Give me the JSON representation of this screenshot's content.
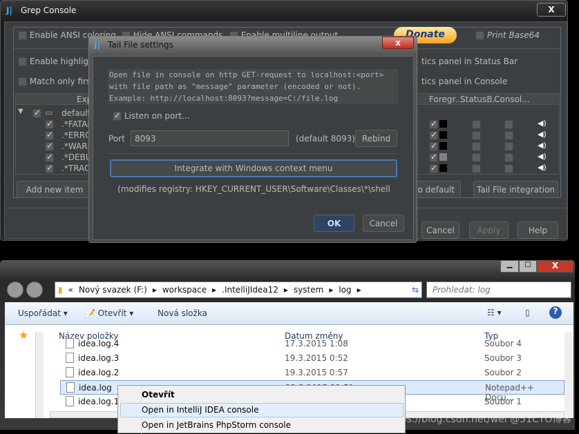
{
  "grep": {
    "title": "Grep Console",
    "close": "X",
    "options": {
      "ansi": "Enable ANSI coloring",
      "hide_ansi": "Hide ANSI commands",
      "multiline": "Enable multiline output",
      "donate": "Donate",
      "base64": "Print Base64",
      "highlight": "Enable highlighting",
      "match_first": "Match only first",
      "stats_status": "tics panel in Status Bar",
      "stats_console": "tics panel in Console"
    },
    "table": {
      "headers": [
        "Exp",
        "Foregr...",
        "StatusB...",
        "Consol..."
      ],
      "rows": [
        {
          "expr": "default",
          "checked": true,
          "folder": true
        },
        {
          "expr": ".*FATAL",
          "checked": true,
          "fg": "#000000"
        },
        {
          "expr": ".*ERROR",
          "checked": true,
          "fg": "#000000"
        },
        {
          "expr": ".*WARN",
          "checked": true,
          "fg": "#000000"
        },
        {
          "expr": ".*DEBUG",
          "checked": true,
          "fg": "#808080"
        },
        {
          "expr": ".*TRACE",
          "checked": true,
          "fg": "#000000"
        }
      ]
    },
    "buttons": {
      "add": "Add new item",
      "reset": "to default",
      "tail": "Tail File integration",
      "cancel": "Cancel",
      "apply": "Apply",
      "help": "Help"
    }
  },
  "tail": {
    "title": "Tail File settings",
    "close": "x",
    "desc": [
      "Open file in console on http GET-request to localhost:<port>",
      "with file path as \"message\" parameter (encoded or not).",
      "Example: http://localhost:8093?message=C:/file.log"
    ],
    "listen": "Listen on port...",
    "listen_checked": true,
    "port_label": "Port",
    "port_value": "8093",
    "port_default": "(default 8093)",
    "rebind": "Rebind",
    "integrate": "Integrate with Windows context menu",
    "registry": "(modifies registry: HKEY_CURRENT_USER\\Software\\Classes\\*\\shell",
    "ok": "OK",
    "cancel": "Cancel"
  },
  "explorer": {
    "path": [
      "«",
      "Nový svazek (F:)",
      "workspace",
      ".IntelliJIdea12",
      "system",
      "log"
    ],
    "search_placeholder": "Prohledat: log",
    "toolbar": {
      "organize": "Uspořádat",
      "open": "Otevřít",
      "new_folder": "Nová složka"
    },
    "columns": [
      "Název položky",
      "Datum změny",
      "Typ"
    ],
    "files": [
      {
        "name": "idea.log.4",
        "date": "17.3.2015 1:08",
        "type": "Soubor 4"
      },
      {
        "name": "idea.log.3",
        "date": "19.3.2015 0:52",
        "type": "Soubor 3"
      },
      {
        "name": "idea.log.2",
        "date": "19.3.2015 0:57",
        "type": "Soubor 2"
      },
      {
        "name": "idea.log",
        "date": "22.3.2015 22:51",
        "type": "Notepad++ Docu...",
        "selected": true
      },
      {
        "name": "idea.log.1",
        "date": "",
        "type": "Soubor 1"
      }
    ],
    "context_menu": [
      "Otevřít",
      "Open in IntelliJ IDEA console",
      "Open in JetBrains PhpStorm console"
    ],
    "watermark": "https://blog.csdn.net/wei @51CTO博客"
  }
}
